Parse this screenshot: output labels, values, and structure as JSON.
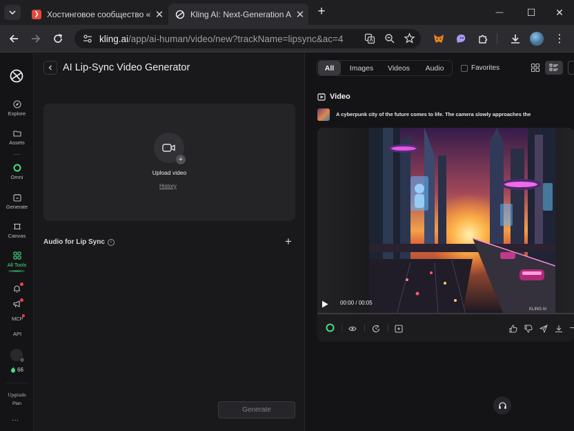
{
  "browser": {
    "tabs": [
      {
        "title": "Хостинговое сообщество «Tim",
        "active": false
      },
      {
        "title": "Kling AI: Next-Generation AI Cr",
        "active": true
      }
    ],
    "new_tab": "+",
    "window": {
      "minimize": "—",
      "maximize": "☐",
      "close": "✕"
    },
    "url_host": "kling.ai",
    "url_path": "/app/ai-human/video/new?trackName=lipsync&ac=4"
  },
  "sidebar": {
    "items": [
      {
        "label": "Explore"
      },
      {
        "label": "Assets"
      },
      {
        "label": "Omni"
      },
      {
        "label": "Generate"
      },
      {
        "label": "Canvas"
      },
      {
        "label": "All Tools"
      },
      {
        "label": "MCP"
      },
      {
        "label": "API"
      }
    ],
    "credits": "66",
    "upgrade_top": "Upgrade",
    "upgrade_bottom": "Plan",
    "more": "···",
    "active_color": "#4ade80"
  },
  "left": {
    "back": "‹",
    "title": "AI Lip-Sync Video Generator",
    "upload_label": "Upload video",
    "history_link": "History",
    "audio_label": "Audio for Lip Sync",
    "info": "i",
    "add": "+",
    "generate": "Generate"
  },
  "right": {
    "filters": [
      "All",
      "Images",
      "Videos",
      "Audio"
    ],
    "favorites": "Favorites",
    "section_title": "Video",
    "prompt": "A cyberpunk city of the future comes to life. The camera slowly approaches the",
    "time": "00:00 / 00:05",
    "watermark": "KLING AI",
    "support_icon": "headset-icon"
  }
}
